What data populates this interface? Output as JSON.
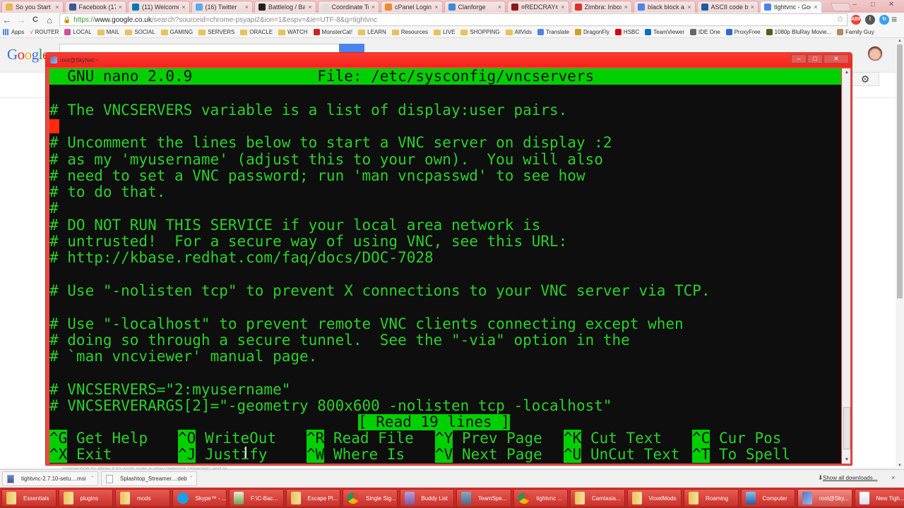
{
  "browser": {
    "tabs": [
      {
        "label": "So you Start",
        "icon_color": "#e8b84a"
      },
      {
        "label": "Facebook (17)",
        "icon_color": "#3b5998"
      },
      {
        "label": "(11) Welcome!",
        "icon_color": "#0077b5"
      },
      {
        "label": "(16) Twitter",
        "icon_color": "#55acee"
      },
      {
        "label": "Battlelog / Batt",
        "icon_color": "#222222"
      },
      {
        "label": "Coordinate To",
        "icon_color": "#dddddd"
      },
      {
        "label": "cPanel Login",
        "icon_color": "#f08a2a"
      },
      {
        "label": "Clanforge",
        "icon_color": "#3a8ad6"
      },
      {
        "label": "¤REDCRAY¤",
        "icon_color": "#8a1a1a"
      },
      {
        "label": "Zimbra: Inbox",
        "icon_color": "#d9342b"
      },
      {
        "label": "black block as",
        "icon_color": "#4a84ea"
      },
      {
        "label": "ASCII code bla",
        "icon_color": "#1e5aa8"
      },
      {
        "label": "tightvnc - Goo",
        "icon_color": "#4a84ea",
        "active": true
      }
    ],
    "tab_close_glyph": "×",
    "window_controls": {
      "minimize": "–",
      "maximize": "□",
      "close": "✕"
    },
    "nav": {
      "back": "←",
      "forward": "→",
      "reload": "C",
      "home": "⌂"
    },
    "url": {
      "scheme": "https://",
      "host": "www.google.co.uk",
      "rest": "/search?sourceid=chrome-psyapi2&ion=1&espv=&ie=UTF-8&q=tightvnc"
    },
    "bookmark_star": "☆",
    "extensions": [
      {
        "name": "abp-icon",
        "label": "ABP",
        "color": "#e8453c"
      },
      {
        "name": "pulse-icon",
        "label": "⌇",
        "color": "#555555"
      },
      {
        "name": "sync-icon",
        "label": "↻",
        "color": "#3aa0e8"
      }
    ],
    "menu_glyph": "≡",
    "bookmarks": [
      {
        "label": "Apps",
        "type": "apps"
      },
      {
        "label": "ROUTER",
        "type": "check"
      },
      {
        "label": "LOCAL",
        "type": "icon",
        "color": "#d84a9a"
      },
      {
        "label": "MAIL",
        "type": "folder"
      },
      {
        "label": "SOCIAL",
        "type": "folder"
      },
      {
        "label": "GAMING",
        "type": "folder"
      },
      {
        "label": "SERVERS",
        "type": "folder"
      },
      {
        "label": "ORACLE",
        "type": "folder"
      },
      {
        "label": "WATCH",
        "type": "folder"
      },
      {
        "label": "MonsterCat!",
        "type": "icon",
        "color": "#cc2222"
      },
      {
        "label": "LEARN",
        "type": "folder"
      },
      {
        "label": "Resources",
        "type": "folder"
      },
      {
        "label": "LIVE",
        "type": "folder"
      },
      {
        "label": "SHOPPING",
        "type": "folder"
      },
      {
        "label": "AllVids",
        "type": "folder"
      },
      {
        "label": "Translate",
        "type": "icon",
        "color": "#4a84ea"
      },
      {
        "label": "DragonFly",
        "type": "icon",
        "color": "#c9a227"
      },
      {
        "label": "HSBC",
        "type": "icon",
        "color": "#db0011"
      },
      {
        "label": "TeamViewer",
        "type": "icon",
        "color": "#0e6dc4"
      },
      {
        "label": "IDE One",
        "type": "icon",
        "color": "#666666"
      },
      {
        "label": "ProxyFree",
        "type": "icon",
        "color": "#2a6ad6"
      },
      {
        "label": "1080p BluRay Movie...",
        "type": "icon",
        "color": "#5a5a1a"
      },
      {
        "label": "Family Guy",
        "type": "icon",
        "color": "#b08a5a"
      }
    ]
  },
  "google": {
    "logo_letters": [
      {
        "ch": "G",
        "color": "#3a6ee0"
      },
      {
        "ch": "o",
        "color": "#d9342b"
      },
      {
        "ch": "o",
        "color": "#e8b32a"
      },
      {
        "ch": "g",
        "color": "#3a6ee0"
      },
      {
        "ch": "l",
        "color": "#2a9a3a"
      },
      {
        "ch": "e",
        "color": "#d9342b"
      }
    ],
    "settings_glyph": "⚙"
  },
  "putty": {
    "title": "root@SkyNet:~",
    "controls": {
      "minimize": "–",
      "maximize": "□",
      "close": "✕"
    }
  },
  "nano": {
    "header": "  GNU nano 2.0.9              File: /etc/sysconfig/vncservers",
    "lines": [
      "",
      "# The VNCSERVERS variable is a list of display:user pairs.",
      "",
      "# Uncomment the lines below to start a VNC server on display :2",
      "# as my 'myusername' (adjust this to your own).  You will also",
      "# need to set a VNC password; run 'man vncpasswd' to see how",
      "# to do that.",
      "#",
      "# DO NOT RUN THIS SERVICE if your local area network is",
      "# untrusted!  For a secure way of using VNC, see this URL:",
      "# http://kbase.redhat.com/faq/docs/DOC-7028",
      "",
      "# Use \"-nolisten tcp\" to prevent X connections to your VNC server via TCP.",
      "",
      "# Use \"-localhost\" to prevent remote VNC clients connecting except when",
      "# doing so through a secure tunnel.  See the \"-via\" option in the",
      "# `man vncviewer' manual page.",
      "",
      "# VNCSERVERS=\"2:myusername\"",
      "# VNCSERVERARGS[2]=\"-geometry 800x600 -nolisten tcp -localhost\""
    ],
    "status": "[ Read 19 lines ]",
    "shortcuts_row1": [
      {
        "key": "^G",
        "label": " Get Help"
      },
      {
        "key": "^O",
        "label": " WriteOut"
      },
      {
        "key": "^R",
        "label": " Read File"
      },
      {
        "key": "^Y",
        "label": " Prev Page"
      },
      {
        "key": "^K",
        "label": " Cut Text"
      },
      {
        "key": "^C",
        "label": " Cur Pos"
      }
    ],
    "shortcuts_row2": [
      {
        "key": "^X",
        "label": " Exit"
      },
      {
        "key": "^J",
        "label": " Justify"
      },
      {
        "key": "^W",
        "label": " Where Is"
      },
      {
        "key": "^V",
        "label": " Next Page"
      },
      {
        "key": "^U",
        "label": " UnCut Text"
      },
      {
        "key": "^T",
        "label": " To Spell"
      }
    ]
  },
  "page_snippet": "connection to allow it to work over a slow network (Internet) and is ...",
  "downloads": {
    "items": [
      {
        "label": "tightvnc-2.7.10-setu....msi"
      },
      {
        "label": "Splashtop_Streamer....deb"
      }
    ],
    "caret": "ˇ",
    "show_all": "Show all downloads...",
    "show_all_glyph": "⬇",
    "close": "×"
  },
  "taskbar": {
    "items": [
      {
        "label": "Essentials",
        "icon": "folder"
      },
      {
        "label": "plugins",
        "icon": "folder"
      },
      {
        "label": "mods",
        "icon": "folder"
      },
      {
        "label": "Skype™ - ...",
        "icon": "skype"
      },
      {
        "label": "F:\\C-Bac...",
        "icon": "notepad"
      },
      {
        "label": "Escape Pl...",
        "icon": "folder"
      },
      {
        "label": "Single Sig...",
        "icon": "chrome"
      },
      {
        "label": "Buddy List",
        "icon": "pidgin"
      },
      {
        "label": "TeamSpe...",
        "icon": "teamspeak"
      },
      {
        "label": "tightvnc ...",
        "icon": "chrome"
      },
      {
        "label": "Camtasia...",
        "icon": "folder"
      },
      {
        "label": "VoxelMods",
        "icon": "folder"
      },
      {
        "label": "Roaming",
        "icon": "folder"
      },
      {
        "label": "Computer",
        "icon": "computer"
      },
      {
        "label": "root@Sky...",
        "icon": "putty",
        "active": true
      },
      {
        "label": "New Tigh...",
        "icon": "vnc"
      }
    ]
  }
}
